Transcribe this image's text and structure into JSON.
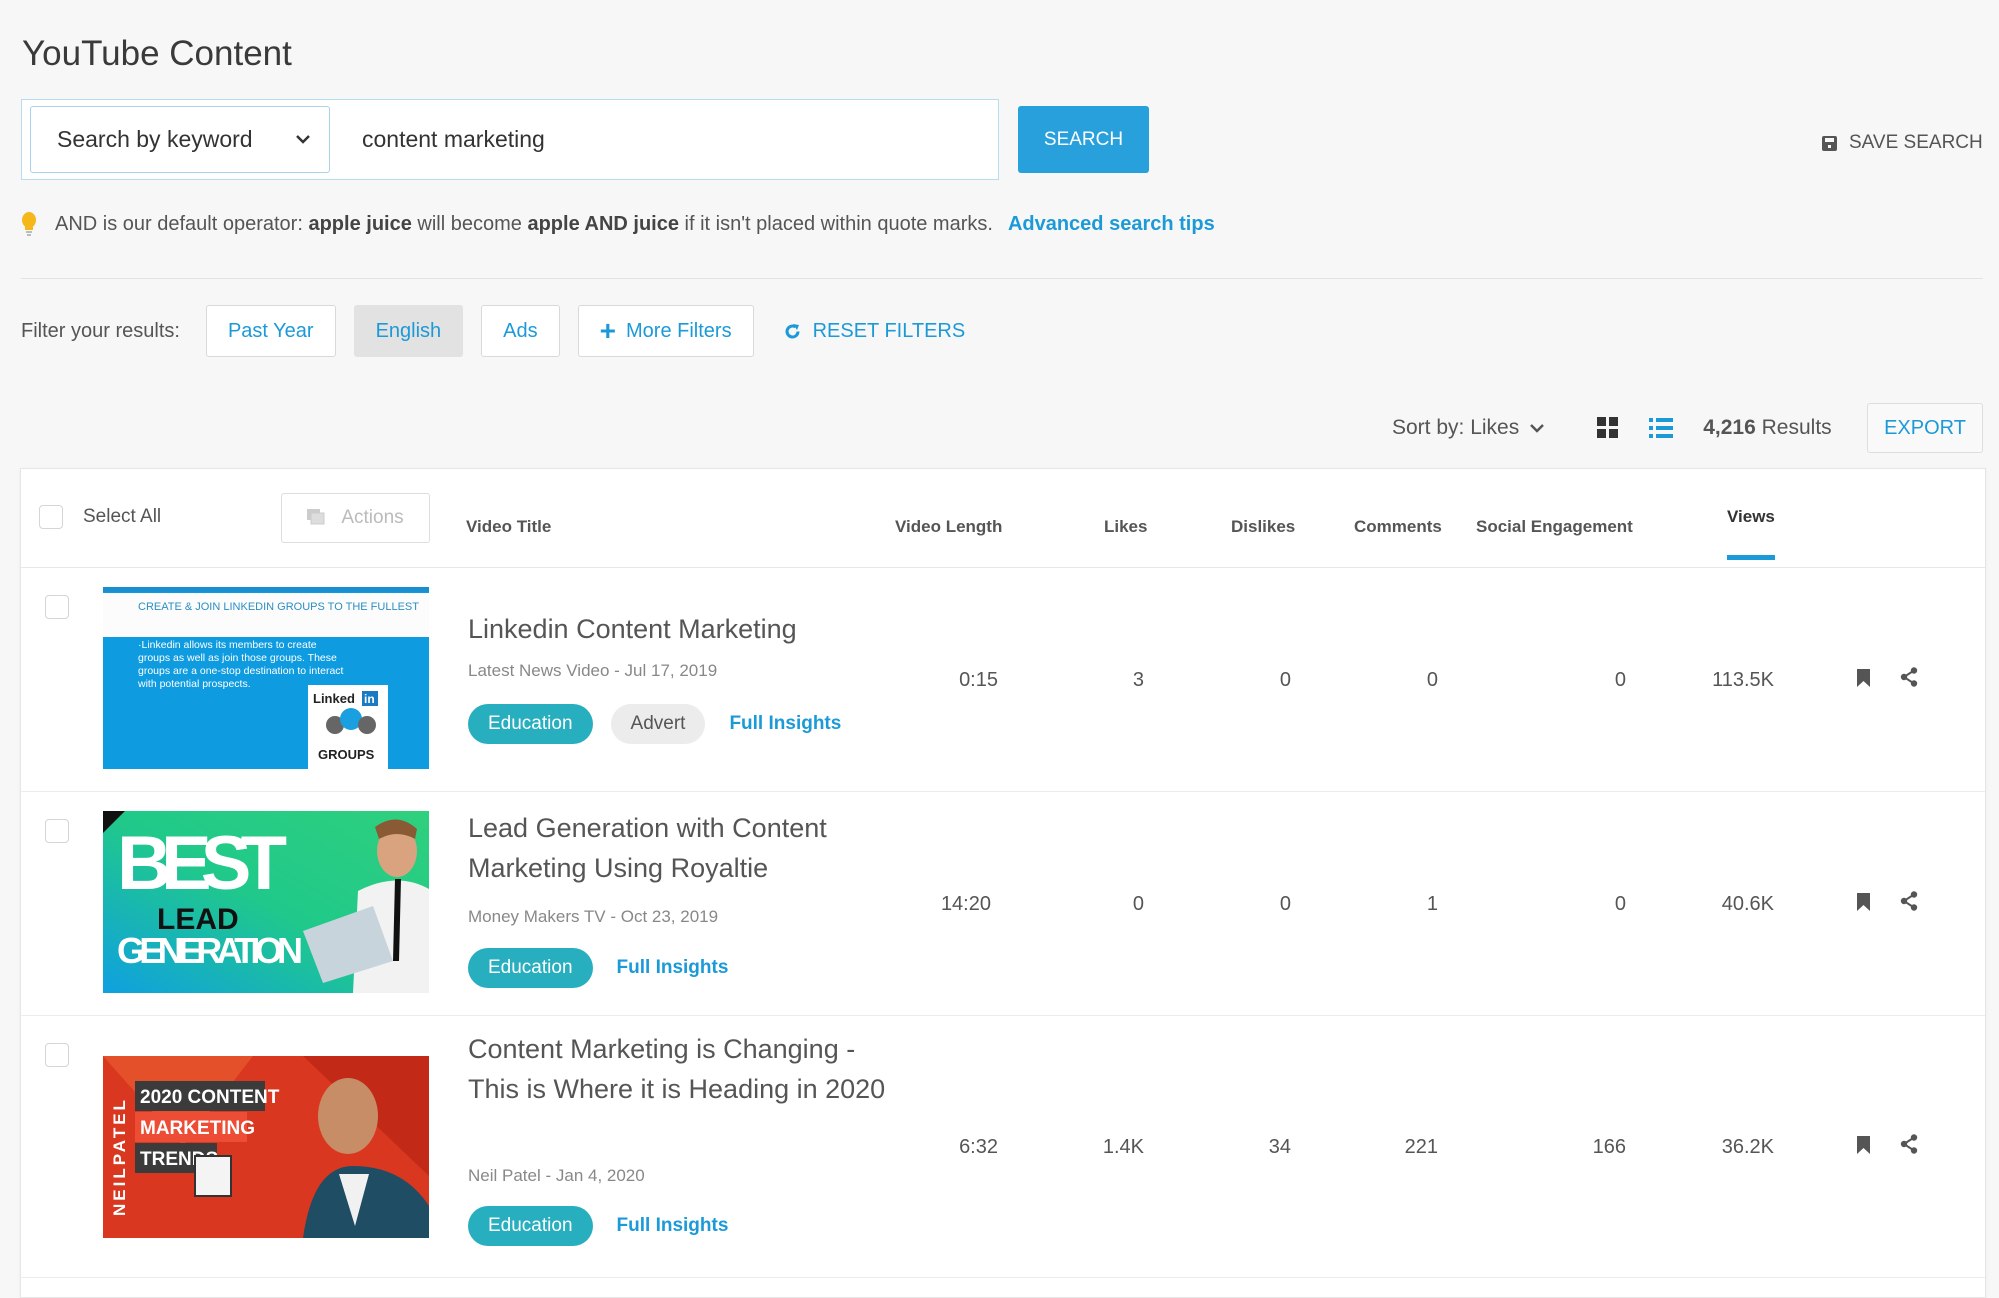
{
  "page": {
    "title": "YouTube Content"
  },
  "search": {
    "mode_label": "Search by keyword",
    "query": "content marketing",
    "search_button": "SEARCH",
    "save_search": "SAVE SEARCH"
  },
  "hint": {
    "prefix": "AND is our default operator:",
    "ex1": "apple juice",
    "mid": "will become",
    "ex2": "apple AND juice",
    "suffix": "if it isn't placed within quote marks.",
    "link": "Advanced search tips"
  },
  "filters": {
    "label": "Filter your results:",
    "buttons": [
      {
        "label": "Past Year",
        "active": false
      },
      {
        "label": "English",
        "active": true
      },
      {
        "label": "Ads",
        "active": false
      },
      {
        "label": "More Filters",
        "active": false
      }
    ],
    "reset": "RESET FILTERS"
  },
  "toolbar": {
    "sort_label": "Sort by: Likes",
    "results_count": "4,216",
    "results_label": "Results",
    "export": "EXPORT",
    "view_mode": "list"
  },
  "table": {
    "select_all": "Select All",
    "actions": "Actions",
    "columns": {
      "title": "Video Title",
      "length": "Video Length",
      "likes": "Likes",
      "dislikes": "Dislikes",
      "comments": "Comments",
      "social": "Social Engagement",
      "views": "Views"
    },
    "sorted_column": "Views",
    "rows": [
      {
        "title": "Linkedin Content Marketing",
        "meta": "Latest News Video - Jul 17, 2019",
        "tags": [
          "Education",
          "Advert"
        ],
        "insights": "Full Insights",
        "length": "0:15",
        "likes": "3",
        "dislikes": "0",
        "comments": "0",
        "social": "0",
        "views": "113.5K",
        "thumb": {
          "line1": "CREATE & JOIN LINKEDIN GROUPS TO THE FULLEST",
          "body": "·Linkedin allows its members to create groups as well as join those groups. These groups are a one-stop destination to interact with potential prospects.",
          "logo": "Linked",
          "logo_in": "in",
          "badge": "GROUPS"
        }
      },
      {
        "title": "Lead Generation with Content Marketing Using Royaltie",
        "meta": "Money Makers TV - Oct 23, 2019",
        "tags": [
          "Education"
        ],
        "insights": "Full Insights",
        "length": "14:20",
        "likes": "0",
        "dislikes": "0",
        "comments": "1",
        "social": "0",
        "views": "40.6K",
        "thumb": {
          "line1": "BEST",
          "line2": "LEAD",
          "line3": "GENERATION"
        }
      },
      {
        "title": "Content Marketing is Changing - This is Where it is Heading in 2020",
        "meta": "Neil Patel - Jan 4, 2020",
        "tags": [
          "Education"
        ],
        "insights": "Full Insights",
        "length": "6:32",
        "likes": "1.4K",
        "dislikes": "34",
        "comments": "221",
        "social": "166",
        "views": "36.2K",
        "thumb": {
          "side": "NEILPATEL",
          "line1": "2020 CONTENT",
          "line2": "MARKETING",
          "line3": "TRENDS"
        }
      }
    ]
  },
  "colors": {
    "accent": "#1c9ad8",
    "search_button": "#27a0dc",
    "education_tag": "#27aebf",
    "active_filter": "#e2e2e2"
  }
}
